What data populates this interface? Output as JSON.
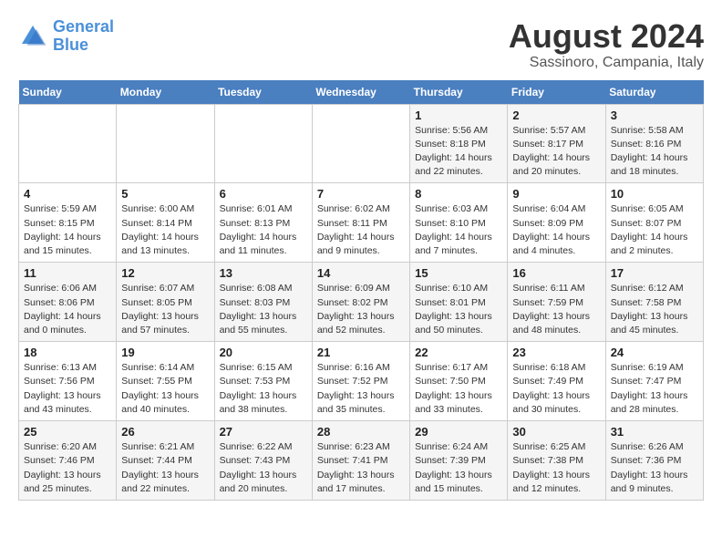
{
  "header": {
    "logo_line1": "General",
    "logo_line2": "Blue",
    "title": "August 2024",
    "subtitle": "Sassinoro, Campania, Italy"
  },
  "weekdays": [
    "Sunday",
    "Monday",
    "Tuesday",
    "Wednesday",
    "Thursday",
    "Friday",
    "Saturday"
  ],
  "weeks": [
    [
      {
        "num": "",
        "info": ""
      },
      {
        "num": "",
        "info": ""
      },
      {
        "num": "",
        "info": ""
      },
      {
        "num": "",
        "info": ""
      },
      {
        "num": "1",
        "info": "Sunrise: 5:56 AM\nSunset: 8:18 PM\nDaylight: 14 hours\nand 22 minutes."
      },
      {
        "num": "2",
        "info": "Sunrise: 5:57 AM\nSunset: 8:17 PM\nDaylight: 14 hours\nand 20 minutes."
      },
      {
        "num": "3",
        "info": "Sunrise: 5:58 AM\nSunset: 8:16 PM\nDaylight: 14 hours\nand 18 minutes."
      }
    ],
    [
      {
        "num": "4",
        "info": "Sunrise: 5:59 AM\nSunset: 8:15 PM\nDaylight: 14 hours\nand 15 minutes."
      },
      {
        "num": "5",
        "info": "Sunrise: 6:00 AM\nSunset: 8:14 PM\nDaylight: 14 hours\nand 13 minutes."
      },
      {
        "num": "6",
        "info": "Sunrise: 6:01 AM\nSunset: 8:13 PM\nDaylight: 14 hours\nand 11 minutes."
      },
      {
        "num": "7",
        "info": "Sunrise: 6:02 AM\nSunset: 8:11 PM\nDaylight: 14 hours\nand 9 minutes."
      },
      {
        "num": "8",
        "info": "Sunrise: 6:03 AM\nSunset: 8:10 PM\nDaylight: 14 hours\nand 7 minutes."
      },
      {
        "num": "9",
        "info": "Sunrise: 6:04 AM\nSunset: 8:09 PM\nDaylight: 14 hours\nand 4 minutes."
      },
      {
        "num": "10",
        "info": "Sunrise: 6:05 AM\nSunset: 8:07 PM\nDaylight: 14 hours\nand 2 minutes."
      }
    ],
    [
      {
        "num": "11",
        "info": "Sunrise: 6:06 AM\nSunset: 8:06 PM\nDaylight: 14 hours\nand 0 minutes."
      },
      {
        "num": "12",
        "info": "Sunrise: 6:07 AM\nSunset: 8:05 PM\nDaylight: 13 hours\nand 57 minutes."
      },
      {
        "num": "13",
        "info": "Sunrise: 6:08 AM\nSunset: 8:03 PM\nDaylight: 13 hours\nand 55 minutes."
      },
      {
        "num": "14",
        "info": "Sunrise: 6:09 AM\nSunset: 8:02 PM\nDaylight: 13 hours\nand 52 minutes."
      },
      {
        "num": "15",
        "info": "Sunrise: 6:10 AM\nSunset: 8:01 PM\nDaylight: 13 hours\nand 50 minutes."
      },
      {
        "num": "16",
        "info": "Sunrise: 6:11 AM\nSunset: 7:59 PM\nDaylight: 13 hours\nand 48 minutes."
      },
      {
        "num": "17",
        "info": "Sunrise: 6:12 AM\nSunset: 7:58 PM\nDaylight: 13 hours\nand 45 minutes."
      }
    ],
    [
      {
        "num": "18",
        "info": "Sunrise: 6:13 AM\nSunset: 7:56 PM\nDaylight: 13 hours\nand 43 minutes."
      },
      {
        "num": "19",
        "info": "Sunrise: 6:14 AM\nSunset: 7:55 PM\nDaylight: 13 hours\nand 40 minutes."
      },
      {
        "num": "20",
        "info": "Sunrise: 6:15 AM\nSunset: 7:53 PM\nDaylight: 13 hours\nand 38 minutes."
      },
      {
        "num": "21",
        "info": "Sunrise: 6:16 AM\nSunset: 7:52 PM\nDaylight: 13 hours\nand 35 minutes."
      },
      {
        "num": "22",
        "info": "Sunrise: 6:17 AM\nSunset: 7:50 PM\nDaylight: 13 hours\nand 33 minutes."
      },
      {
        "num": "23",
        "info": "Sunrise: 6:18 AM\nSunset: 7:49 PM\nDaylight: 13 hours\nand 30 minutes."
      },
      {
        "num": "24",
        "info": "Sunrise: 6:19 AM\nSunset: 7:47 PM\nDaylight: 13 hours\nand 28 minutes."
      }
    ],
    [
      {
        "num": "25",
        "info": "Sunrise: 6:20 AM\nSunset: 7:46 PM\nDaylight: 13 hours\nand 25 minutes."
      },
      {
        "num": "26",
        "info": "Sunrise: 6:21 AM\nSunset: 7:44 PM\nDaylight: 13 hours\nand 22 minutes."
      },
      {
        "num": "27",
        "info": "Sunrise: 6:22 AM\nSunset: 7:43 PM\nDaylight: 13 hours\nand 20 minutes."
      },
      {
        "num": "28",
        "info": "Sunrise: 6:23 AM\nSunset: 7:41 PM\nDaylight: 13 hours\nand 17 minutes."
      },
      {
        "num": "29",
        "info": "Sunrise: 6:24 AM\nSunset: 7:39 PM\nDaylight: 13 hours\nand 15 minutes."
      },
      {
        "num": "30",
        "info": "Sunrise: 6:25 AM\nSunset: 7:38 PM\nDaylight: 13 hours\nand 12 minutes."
      },
      {
        "num": "31",
        "info": "Sunrise: 6:26 AM\nSunset: 7:36 PM\nDaylight: 13 hours\nand 9 minutes."
      }
    ]
  ]
}
